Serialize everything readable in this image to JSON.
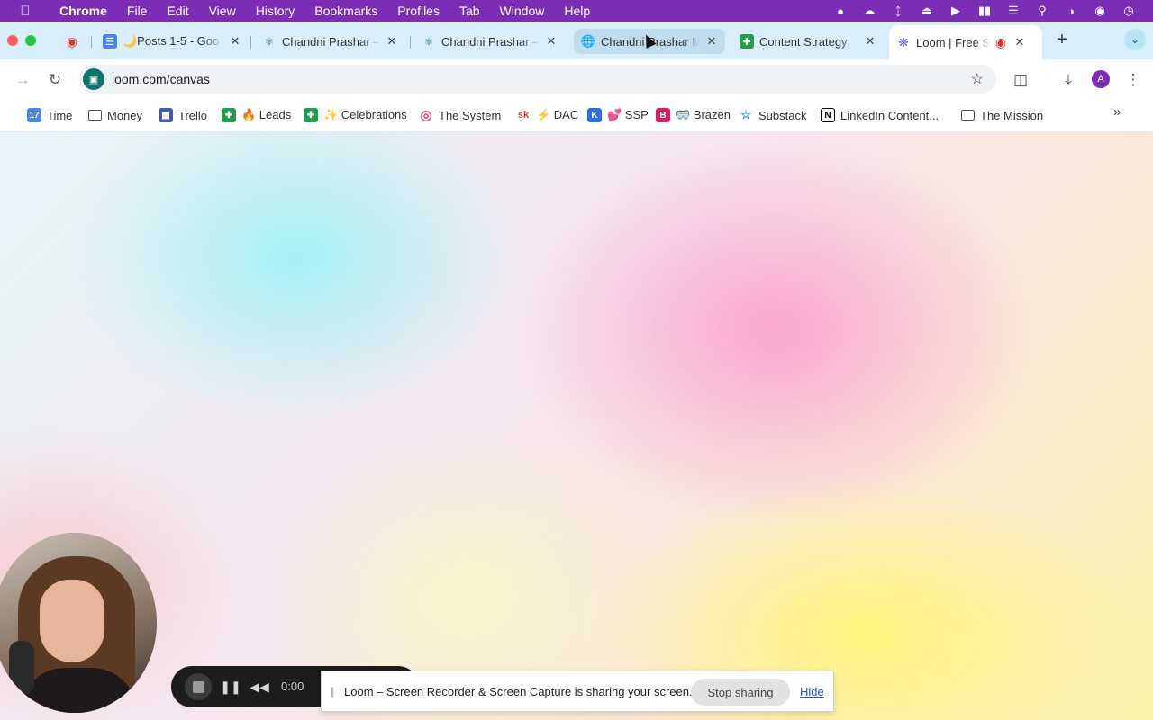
{
  "menubar": {
    "app": "Chrome",
    "items": [
      "File",
      "Edit",
      "View",
      "History",
      "Bookmarks",
      "Profiles",
      "Tab",
      "Window",
      "Help"
    ],
    "status_icons": [
      "mic-icon",
      "creative-cloud-icon",
      "bluetooth-icon",
      "eject-icon",
      "play-icon",
      "battery-icon",
      "wifi-icon",
      "search-icon",
      "control-center-icon",
      "siri-icon",
      "clock-icon"
    ]
  },
  "tabs": [
    {
      "title": "",
      "icon": "record-icon"
    },
    {
      "title": "🌙Posts 1-5 - Goo",
      "icon": "google-docs-icon"
    },
    {
      "title": "Chandni Prashar –",
      "icon": "sprout-icon"
    },
    {
      "title": "Chandni Prashar –",
      "icon": "sprout-icon"
    },
    {
      "title": "Chandni Prashar M",
      "icon": "globe-icon"
    },
    {
      "title": "Content Strategy:",
      "icon": "google-sheets-icon"
    },
    {
      "title": "Loom | Free Sc",
      "icon": "loom-icon"
    }
  ],
  "toolbar": {
    "url": "loom.com/canvas",
    "avatar_letter": "A"
  },
  "bookmarks": [
    {
      "label": "Time",
      "icon": "calendar-icon",
      "badge": "17"
    },
    {
      "label": "Money",
      "icon": "folder-icon"
    },
    {
      "label": "Trello",
      "icon": "trello-icon"
    },
    {
      "label": "🔥 Leads",
      "icon": "sheets-icon"
    },
    {
      "label": "✨ Celebrations",
      "icon": "sheets-icon"
    },
    {
      "label": "The System",
      "icon": "target-icon"
    },
    {
      "label": "⚡ DAC",
      "icon": "sk-icon",
      "badge": "sk"
    },
    {
      "label": "💕 SSP",
      "icon": "kajabi-icon"
    },
    {
      "label": "🥽 Brazen",
      "icon": "b-icon",
      "badge": "B"
    },
    {
      "label": "Substack",
      "icon": "substack-icon"
    },
    {
      "label": "LinkedIn Content...",
      "icon": "notion-icon",
      "badge": "N"
    },
    {
      "label": "The Mission",
      "icon": "folder-icon"
    }
  ],
  "loom": {
    "timer": "0:00",
    "share_message": "Loom – Screen Recorder & Screen Capture is sharing your screen.",
    "stop_sharing": "Stop sharing",
    "hide": "Hide"
  }
}
